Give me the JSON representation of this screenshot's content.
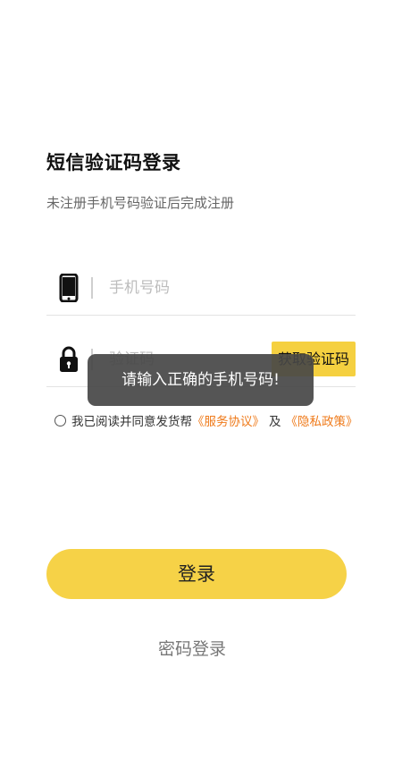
{
  "header": {
    "title": "短信验证码登录",
    "subtitle": "未注册手机号码验证后完成注册"
  },
  "phone": {
    "icon": "phone-icon",
    "value": "",
    "placeholder": "手机号码"
  },
  "code": {
    "icon": "lock-icon",
    "value": "",
    "placeholder": "验证码",
    "send_button": "获取验证码"
  },
  "agreement": {
    "checked": false,
    "prefix": "我已阅读并同意发货帮",
    "service_link": "《服务协议》",
    "and": "及",
    "privacy_link": "《隐私政策》"
  },
  "toast": {
    "message": "请输入正确的手机号码!"
  },
  "actions": {
    "login_label": "登录",
    "password_login_label": "密码登录"
  },
  "colors": {
    "accent": "#f6d247",
    "link": "#ef7a1a",
    "toast_bg": "#464646"
  }
}
